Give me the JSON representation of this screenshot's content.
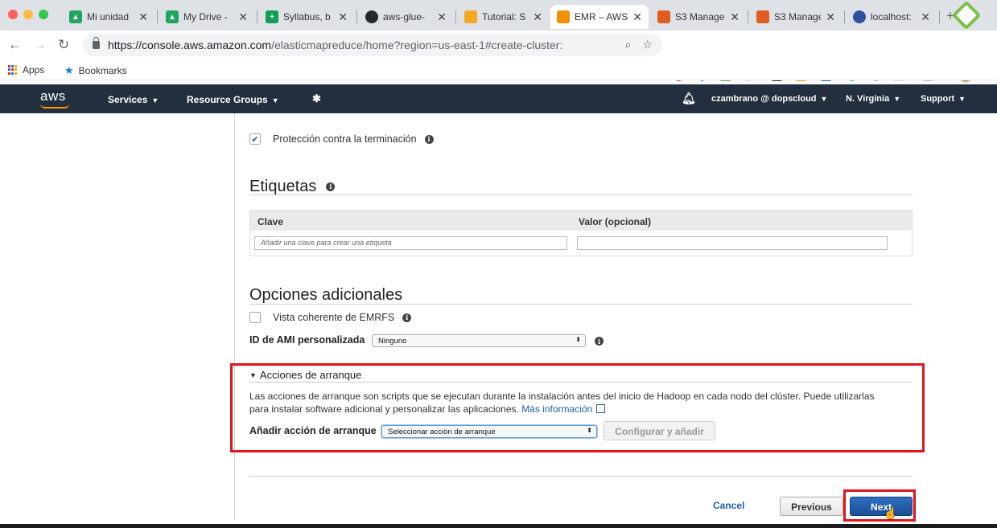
{
  "browser": {
    "tabs": [
      {
        "title": "Mi unidad",
        "icon": "google-drive-icon",
        "color": "#1fa463"
      },
      {
        "title": "My Drive -",
        "icon": "google-drive-icon",
        "color": "#1fa463"
      },
      {
        "title": "Syllabus, b",
        "icon": "google-sheets-icon",
        "color": "#0f9d58"
      },
      {
        "title": "aws-glue-",
        "icon": "github-icon",
        "color": "#24292e"
      },
      {
        "title": "Tutorial: S",
        "icon": "aws-docs-icon",
        "color": "#f5a623"
      },
      {
        "title": "EMR – AWS",
        "icon": "aws-emr-icon",
        "color": "#f29100",
        "active": true
      },
      {
        "title": "S3 Manage",
        "icon": "aws-s3-icon",
        "color": "#e25b1f"
      },
      {
        "title": "S3 Manage",
        "icon": "aws-s3-icon",
        "color": "#e25b1f"
      },
      {
        "title": "localhost:",
        "icon": "feather-icon",
        "color": "#2d4ea3"
      }
    ],
    "url_host": "https://console.aws.amazon.com",
    "url_rest": "/elasticmapreduce/home?region=us-east-1#create-cluster:",
    "bookmarks": {
      "apps": "Apps",
      "bookmarks": "Bookmarks"
    }
  },
  "aws_nav": {
    "logo": "aws",
    "services": "Services",
    "resource_groups": "Resource Groups",
    "account": "czambrano @ dopscloud",
    "region": "N. Virginia",
    "support": "Support"
  },
  "termination": {
    "label": "Protección contra la terminación",
    "checked": true
  },
  "tags": {
    "title": "Etiquetas",
    "col_key": "Clave",
    "col_value": "Valor (opcional)",
    "key_placeholder": "Añadir una clave para crear una etiqueta"
  },
  "additional": {
    "title": "Opciones adicionales",
    "emrfs_label": "Vista coherente de EMRFS",
    "emrfs_checked": false,
    "ami_label": "ID de AMI personalizada",
    "ami_value": "Ninguno"
  },
  "bootstrap": {
    "title": "Acciones de arranque",
    "desc_line1": "Las acciones de arranque son scripts que se ejecutan durante la instalación antes del inicio de Hadoop en cada nodo del clúster. Puede utilizarlas",
    "desc_line2": "para instalar software adicional y personalizar las aplicaciones.",
    "more_info": "Más información",
    "add_label": "Añadir acción de arranque",
    "select_value": "Seleccionar acción de arranque",
    "configure_button": "Configurar y añadir"
  },
  "footer": {
    "cancel": "Cancel",
    "previous": "Previous",
    "next": "Next"
  },
  "colors": {
    "highlight": "#e1141b",
    "aws_nav": "#232f3e",
    "primary": "#1f5ea8"
  }
}
